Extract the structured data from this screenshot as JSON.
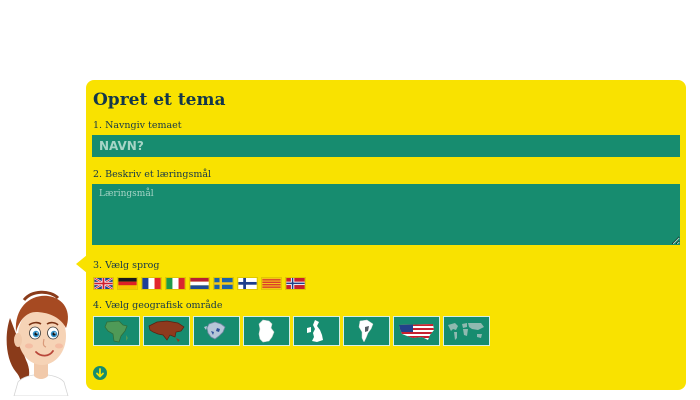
{
  "form": {
    "title": "Opret et tema",
    "step1_label": "1. Navngiv temaet",
    "name_placeholder": "NAVN?",
    "step2_label": "2. Beskriv et læringsmål",
    "goal_placeholder": "Læringsmål",
    "step3_label": "3. Vælg sprog",
    "step4_label": "4. Vælg geografisk område"
  },
  "languages": [
    {
      "icon": "uk-flag-icon"
    },
    {
      "icon": "germany-flag-icon"
    },
    {
      "icon": "france-flag-icon"
    },
    {
      "icon": "italy-flag-icon"
    },
    {
      "icon": "netherlands-flag-icon"
    },
    {
      "icon": "sweden-flag-icon"
    },
    {
      "icon": "finland-flag-icon"
    },
    {
      "icon": "catalonia-flag-icon"
    },
    {
      "icon": "norway-flag-icon"
    }
  ],
  "regions": [
    {
      "icon": "africa-map-icon"
    },
    {
      "icon": "asia-map-icon"
    },
    {
      "icon": "europe-map-icon"
    },
    {
      "icon": "germany-map-icon"
    },
    {
      "icon": "great-britain-map-icon"
    },
    {
      "icon": "south-america-map-icon"
    },
    {
      "icon": "usa-map-icon"
    },
    {
      "icon": "world-map-icon"
    }
  ],
  "colors": {
    "panel": "#f9e200",
    "field": "#178c6f",
    "text": "#13374a"
  }
}
